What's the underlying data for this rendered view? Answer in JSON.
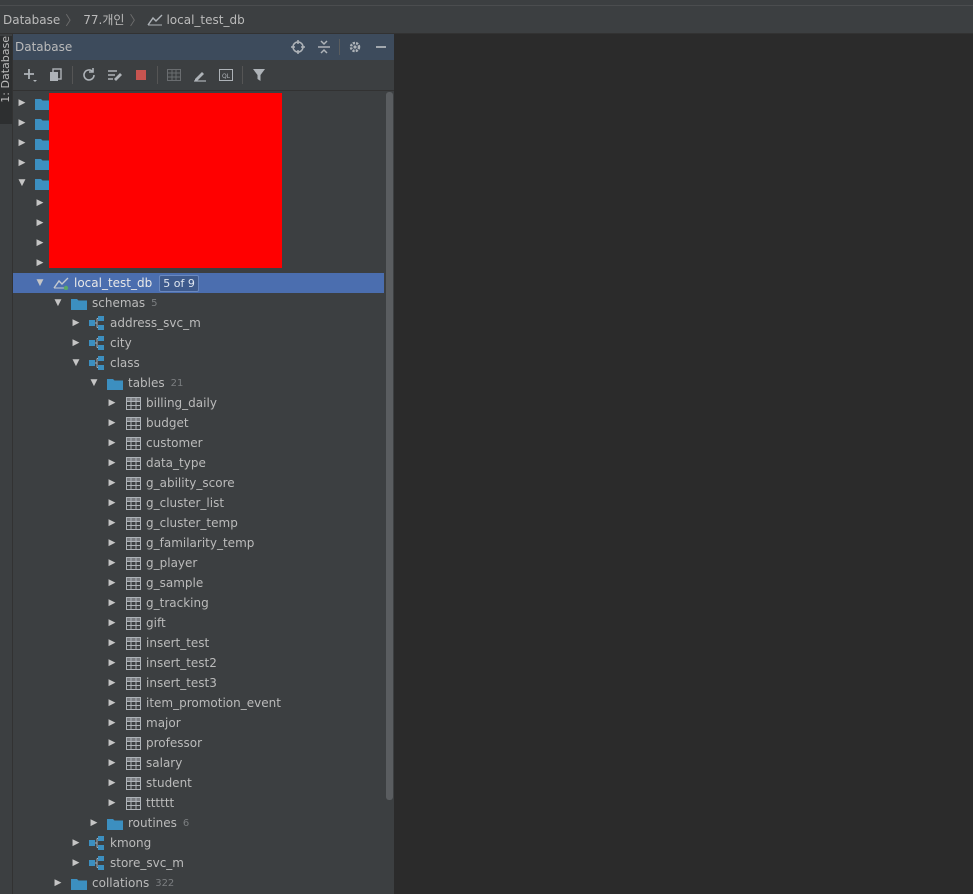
{
  "breadcrumb": {
    "items": [
      "Database",
      "77.개인",
      "local_test_db"
    ]
  },
  "tool_window": {
    "side_tab_label": "1: Database",
    "title": "Database",
    "header_icons": [
      "target-icon",
      "collapse-all-icon",
      "gear-icon",
      "minimize-icon"
    ],
    "toolbar_icons": [
      "add-icon",
      "duplicate-icon",
      "refresh-icon",
      "properties-icon",
      "stop-icon",
      "table-icon",
      "edit-icon",
      "console-icon",
      "filter-icon"
    ]
  },
  "tree": {
    "rows": [
      {
        "level": 0,
        "type": "folder",
        "expanded": false,
        "label": ""
      },
      {
        "level": 0,
        "type": "folder",
        "expanded": false,
        "label": ""
      },
      {
        "level": 0,
        "type": "folder",
        "expanded": false,
        "label": ""
      },
      {
        "level": 0,
        "type": "folder",
        "expanded": false,
        "label": ""
      },
      {
        "level": 0,
        "type": "folder",
        "expanded": true,
        "label": ""
      },
      {
        "level": 1,
        "type": "blank",
        "expanded": false,
        "label": ""
      },
      {
        "level": 1,
        "type": "blank",
        "expanded": false,
        "label": ""
      },
      {
        "level": 1,
        "type": "blank",
        "expanded": false,
        "label": ""
      },
      {
        "level": 1,
        "type": "blank",
        "expanded": false,
        "label": ""
      },
      {
        "level": 1,
        "type": "datasource",
        "expanded": true,
        "label": "local_test_db",
        "badge": "5 of 9",
        "selected": true
      },
      {
        "level": 2,
        "type": "folder",
        "expanded": true,
        "label": "schemas",
        "count": "5"
      },
      {
        "level": 3,
        "type": "schema",
        "expanded": false,
        "label": "address_svc_m"
      },
      {
        "level": 3,
        "type": "schema",
        "expanded": false,
        "label": "city"
      },
      {
        "level": 3,
        "type": "schema",
        "expanded": true,
        "label": "class"
      },
      {
        "level": 4,
        "type": "folder",
        "expanded": true,
        "label": "tables",
        "count": "21"
      },
      {
        "level": 5,
        "type": "table",
        "expanded": false,
        "label": "billing_daily"
      },
      {
        "level": 5,
        "type": "table",
        "expanded": false,
        "label": "budget"
      },
      {
        "level": 5,
        "type": "table",
        "expanded": false,
        "label": "customer"
      },
      {
        "level": 5,
        "type": "table",
        "expanded": false,
        "label": "data_type"
      },
      {
        "level": 5,
        "type": "table",
        "expanded": false,
        "label": "g_ability_score"
      },
      {
        "level": 5,
        "type": "table",
        "expanded": false,
        "label": "g_cluster_list"
      },
      {
        "level": 5,
        "type": "table",
        "expanded": false,
        "label": "g_cluster_temp"
      },
      {
        "level": 5,
        "type": "table",
        "expanded": false,
        "label": "g_familarity_temp"
      },
      {
        "level": 5,
        "type": "table",
        "expanded": false,
        "label": "g_player"
      },
      {
        "level": 5,
        "type": "table",
        "expanded": false,
        "label": "g_sample"
      },
      {
        "level": 5,
        "type": "table",
        "expanded": false,
        "label": "g_tracking"
      },
      {
        "level": 5,
        "type": "table",
        "expanded": false,
        "label": "gift"
      },
      {
        "level": 5,
        "type": "table",
        "expanded": false,
        "label": "insert_test"
      },
      {
        "level": 5,
        "type": "table",
        "expanded": false,
        "label": "insert_test2"
      },
      {
        "level": 5,
        "type": "table",
        "expanded": false,
        "label": "insert_test3"
      },
      {
        "level": 5,
        "type": "table",
        "expanded": false,
        "label": "item_promotion_event"
      },
      {
        "level": 5,
        "type": "table",
        "expanded": false,
        "label": "major"
      },
      {
        "level": 5,
        "type": "table",
        "expanded": false,
        "label": "professor"
      },
      {
        "level": 5,
        "type": "table",
        "expanded": false,
        "label": "salary"
      },
      {
        "level": 5,
        "type": "table",
        "expanded": false,
        "label": "student"
      },
      {
        "level": 5,
        "type": "table",
        "expanded": false,
        "label": "tttttt"
      },
      {
        "level": 4,
        "type": "folder",
        "expanded": false,
        "label": "routines",
        "count": "6"
      },
      {
        "level": 3,
        "type": "schema",
        "expanded": false,
        "label": "kmong"
      },
      {
        "level": 3,
        "type": "schema",
        "expanded": false,
        "label": "store_svc_m"
      },
      {
        "level": 2,
        "type": "folder",
        "expanded": false,
        "label": "collations",
        "count": "322"
      }
    ]
  },
  "colors": {
    "selection": "#4b6eaf",
    "folder": "#3c8fc0",
    "stop": "#c75450",
    "redacted": "#ff0000"
  }
}
